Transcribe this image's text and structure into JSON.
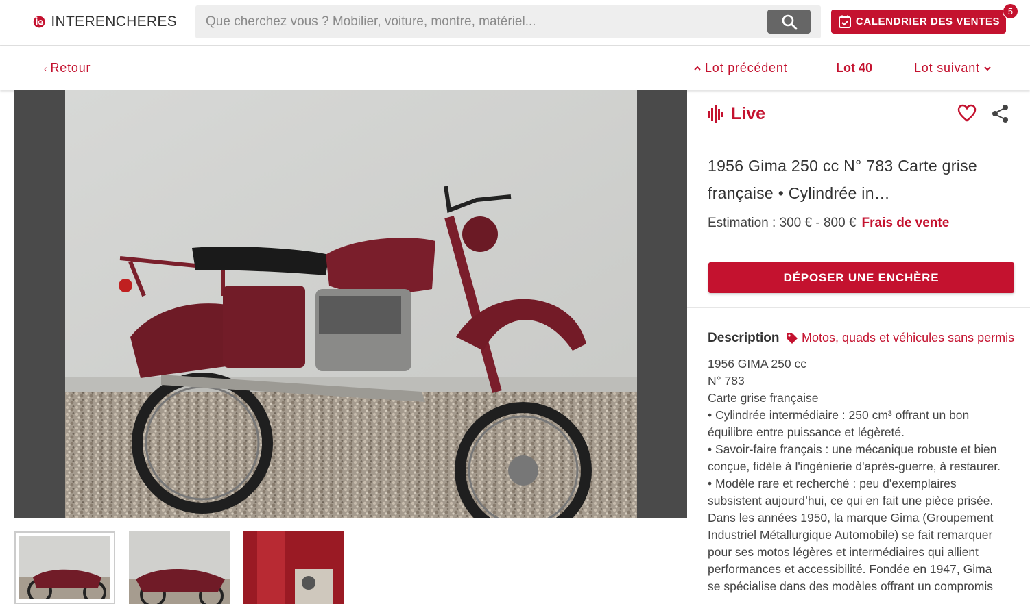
{
  "header": {
    "logo_text": "INTERENCHERES",
    "logo_icon": "ie-logo-mark",
    "search_placeholder": "Que cherchez vous ? Mobilier, voiture, montre, matériel...",
    "search_icon": "search-icon",
    "calendar_label": "CALENDRIER DES VENTES",
    "calendar_icon": "calendar-icon",
    "calendar_badge": "5"
  },
  "nav": {
    "back": "Retour",
    "prev": "Lot précédent",
    "lot": "Lot 40",
    "next": "Lot suivant"
  },
  "gallery": {
    "thumbnail_count": 3
  },
  "lot": {
    "status": "Live",
    "title": "1956 Gima 250 cc N° 783 Carte grise française • Cylindrée in…",
    "estimation": "Estimation : 300 € - 800 €",
    "fees": "Frais de vente",
    "bid_button": "DÉPOSER UNE ENCHÈRE",
    "description_heading": "Description",
    "category": "Motos, quads et véhicules sans permis",
    "description_lines": [
      "1956 GIMA 250 cc",
      "N° 783",
      "Carte grise française",
      "• Cylindrée intermédiaire : 250 cm³ offrant un bon",
      "équilibre entre puissance et légèreté.",
      "• Savoir-faire français : une mécanique robuste et bien",
      "conçue, fidèle à l'ingénierie d'après-guerre, à restaurer.",
      "• Modèle rare et recherché : peu d'exemplaires",
      "subsistent aujourd’hui, ce qui en fait une pièce prisée.",
      "Dans les années 1950, la marque Gima (Groupement",
      "Industriel Métallurgique Automobile) se fait remarquer",
      "pour ses motos légères et intermédiaires qui allient",
      "performances et accessibilité. Fondée en 1947, Gima",
      "se spécialise dans des modèles offrant un compromis"
    ]
  },
  "colors": {
    "brand": "#c4122f",
    "search_button": "#666666",
    "viewer_bg": "#4a4a4a"
  }
}
